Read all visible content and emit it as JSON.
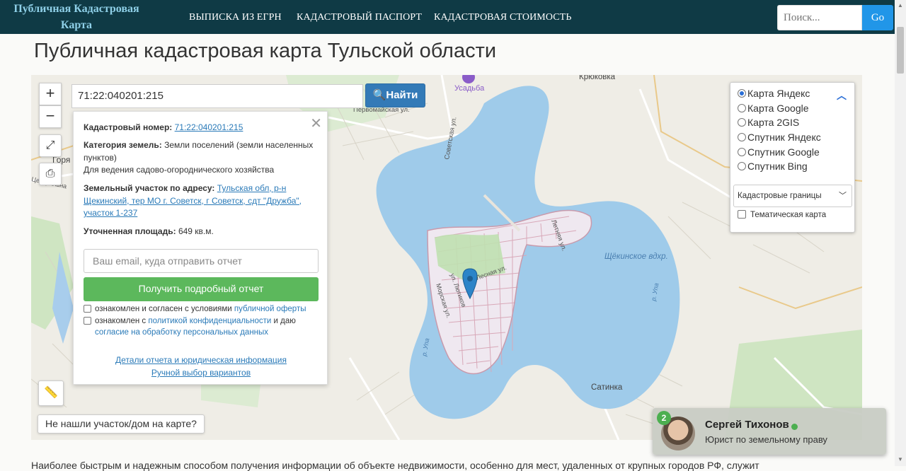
{
  "nav": {
    "brand": "Публичная Кадастровая Карта",
    "links": [
      "ВЫПИСКА ИЗ ЕГРН",
      "КАДАСТРОВЫЙ ПАСПОРТ",
      "КАДАСТРОВАЯ СТОИМОСТЬ"
    ],
    "search_placeholder": "Поиск...",
    "search_button": "Go"
  },
  "page_title": "Публичная кадастровая карта Тульской области",
  "search": {
    "value": "71:22:040201:215",
    "button": "Найти"
  },
  "popup": {
    "cad_label": "Кадастровый номер:",
    "cad_value": "71:22:040201:215",
    "cat_label": "Категория земель:",
    "cat_value": "Земли поселений (земли населенных пунктов)",
    "usage": "Для ведения садово-огороднического хозяйства",
    "addr_label": "Земельный участок по адресу:",
    "addr_value": "Тульская обл, р-н Щекинский, тер МО г. Советск, г Советск, сдт \"Дружба\", участок 1-237",
    "area_label": "Уточненная площадь:",
    "area_value": "649 кв.м.",
    "email_placeholder": "Ваш email, куда отправить отчет",
    "report_button": "Получить подробный отчет",
    "consent1_text": "ознакомлен и согласен с условиями",
    "consent1_link": "публичной оферты",
    "consent2_text": "ознакомлен с",
    "consent2_link": "политикой конфиденциальности",
    "consent2_and": "и даю",
    "consent2_link2": "согласие на обработку персональных данных",
    "details_link": "Детали отчета и юридическая информация",
    "manual_link": "Ручной выбор вариантов"
  },
  "layers": {
    "options": [
      "Карта Яндекс",
      "Карта Google",
      "Карта 2GIS",
      "Спутник Яндекс",
      "Спутник Google",
      "Спутник Bing"
    ],
    "selected": "Карта Яндекс",
    "overlay_select": "Кадастровые границы",
    "thematic": "Тематическая карта"
  },
  "map_labels": {
    "krukovka": "Крюковка",
    "usadba": "Усадьба",
    "pervomayskaya": "Первомайская ул.",
    "sovetskaya": "Советская ул.",
    "gorya": "Горя",
    "tsentralnaya": "Центральна",
    "letnyaya": "Летняя ул.",
    "lesnaya": "Лесная ул.",
    "lutikov": "ул. Лютиков",
    "morskaya": "Морская ул.",
    "reservoir": "Щёкинское вдхр.",
    "upa1": "р. Упа",
    "upa2": "р. Упа",
    "satinka": "Сатинка"
  },
  "not_found": "Не нашли участок/дом на карте?",
  "chat": {
    "badge": "2",
    "name": "Сергей Тихонов",
    "role": "Юрист по земельному праву"
  },
  "bottom_text": "Наиболее быстрым и надежным способом получения информации об объекте недвижимости, особенно для мест, удаленных от крупных городов РФ, служит"
}
